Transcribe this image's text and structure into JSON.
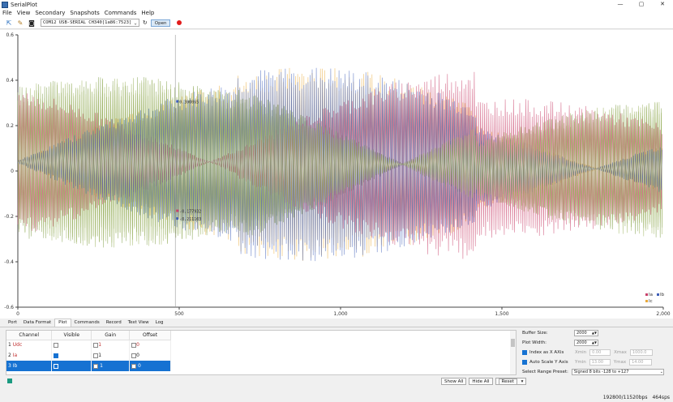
{
  "window": {
    "title": "SerialPlot",
    "min": "—",
    "max": "▢",
    "close": "✕"
  },
  "menu": [
    "File",
    "View",
    "Secondary",
    "Snapshots",
    "Commands",
    "Help"
  ],
  "toolbar": {
    "port": "COM12 USB-SERIAL CH340[1a86:7523]",
    "open_label": "Open",
    "refresh": "↻",
    "rec_color": "#e21b1b"
  },
  "chart_data": {
    "type": "line",
    "xlim": [
      0,
      2000
    ],
    "ylim": [
      -0.6,
      0.6
    ],
    "x_ticks": [
      "0",
      "500",
      "1,000",
      "1,500",
      "2,000"
    ],
    "y_ticks": [
      "0.6",
      "0.4",
      "0.2",
      "0",
      "-0.2",
      "-0.4",
      "-0.6"
    ],
    "series": [
      {
        "name": "Ia",
        "color": "#c8406a"
      },
      {
        "name": "Ib",
        "color": "#3f5fb8"
      },
      {
        "name": "Ic",
        "color": "#e8a93a"
      }
    ],
    "legend_position": "bottom-right",
    "segments": [
      [
        0,
        680,
        0.42,
        -0.34
      ],
      [
        680,
        1420,
        0.46,
        -0.4
      ],
      [
        1420,
        2000,
        0.32,
        -0.3
      ]
    ],
    "cursor": {
      "x": 488,
      "labels": [
        "0.300065",
        "-0.177932",
        "-0.211103"
      ]
    }
  },
  "tabs": [
    "Port",
    "Data Format",
    "Plot",
    "Commands",
    "Record",
    "Text View",
    "Log"
  ],
  "active_tab": "Plot",
  "channels": {
    "headers": [
      "Channel",
      "Visible",
      "Gain",
      "Offset"
    ],
    "rows": [
      {
        "idx": "1",
        "name": "Udc",
        "visible": false,
        "gain": "1",
        "offset": "0"
      },
      {
        "idx": "2",
        "name": "Ia",
        "visible": true,
        "gain": "1",
        "offset": "0"
      },
      {
        "idx": "3",
        "name": "Ib",
        "visible": true,
        "gain": "1",
        "offset": "0"
      }
    ],
    "selected_color": "#1a9a80"
  },
  "buttons": {
    "show_all": "Show All",
    "hide_all": "Hide All",
    "reset": "Reset"
  },
  "settings": {
    "buffer_label": "Buffer Size:",
    "buffer_value": "2000",
    "plot_width_label": "Plot Width:",
    "plot_width_value": "2000",
    "index_as_x": "Index as X AXis",
    "xmin_label": "Xmin",
    "xmin_value": "0.00",
    "xmax_label": "Xmax",
    "xmax_value": "1000.0",
    "auto_scale": "Auto Scale Y Axis",
    "ymin_label": "Ymin",
    "ymin_value": "13.00",
    "ymax_label": "Ymax",
    "ymax_value": "14.00",
    "preset_label": "Select Range Preset:",
    "preset_value": "Signed 8 bits -128 to +127"
  },
  "status": {
    "baud": "192800/11520bps",
    "rate": "464sps"
  }
}
